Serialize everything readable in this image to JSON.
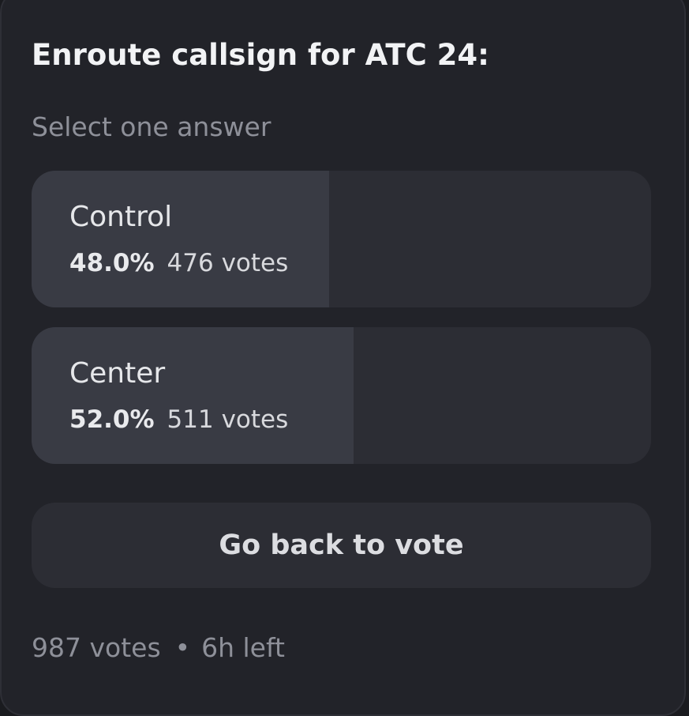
{
  "poll": {
    "question": "Enroute callsign for ATC 24:",
    "instruction": "Select one answer",
    "answers": [
      {
        "label": "Control",
        "percent": "48.0%",
        "votes": "476 votes",
        "fill": 0.48
      },
      {
        "label": "Center",
        "percent": "52.0%",
        "votes": "511 votes",
        "fill": 0.52
      }
    ],
    "back_button_label": "Go back to vote",
    "footer": {
      "total_votes": "987 votes",
      "separator": "•",
      "time_left": "6h left"
    }
  },
  "colors": {
    "card_background": "#222329",
    "answer_background": "#2c2d34",
    "answer_fill": "#393b44",
    "title_text": "#f2f3f5",
    "muted_text": "#8e9099"
  }
}
